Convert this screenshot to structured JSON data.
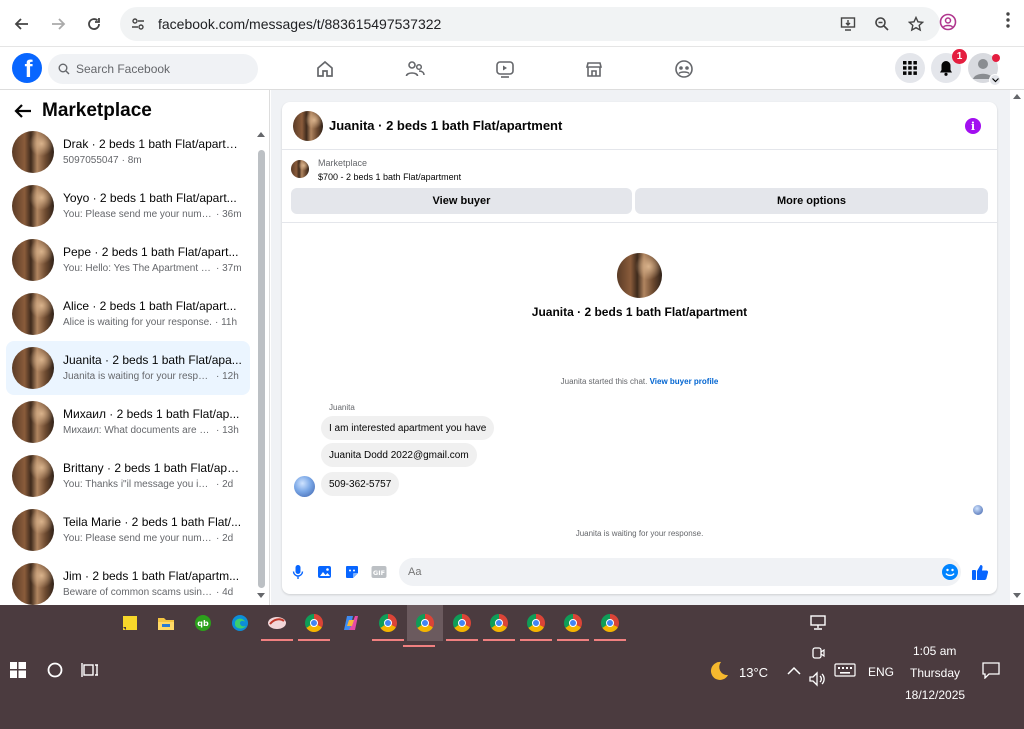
{
  "browser": {
    "url": "facebook.com/messages/t/883615497537322"
  },
  "fb_header": {
    "search_placeholder": "Search Facebook",
    "notification_count": "1"
  },
  "sidebar": {
    "title": "Marketplace",
    "conversations": [
      {
        "name": "Drak · 2 beds 1 bath Flat/apartment",
        "snippet": "5097055047",
        "time": "· 8m",
        "active": false
      },
      {
        "name": "Yoyo · 2 beds 1 bath Flat/apart...",
        "snippet": "You: Please send me your numb...",
        "time": "· 36m",
        "active": false
      },
      {
        "name": "Pepe · 2 beds 1 bath Flat/apart...",
        "snippet": "You: Hello: Yes The Apartment Is ...",
        "time": "· 37m",
        "active": false
      },
      {
        "name": "Alice · 2 beds 1 bath Flat/apart...",
        "snippet": "Alice is waiting for your response.",
        "time": "· 11h",
        "active": false
      },
      {
        "name": "Juanita · 2 beds 1 bath Flat/apa...",
        "snippet": "Juanita is waiting for your respon...",
        "time": "· 12h",
        "active": true
      },
      {
        "name": "Михаил · 2 beds 1 bath Flat/ap...",
        "snippet": "Михаил: What documents are ne...",
        "time": "· 13h",
        "active": false
      },
      {
        "name": "Brittany · 2 beds 1 bath Flat/apa...",
        "snippet": "You: Thanks i\"il message you in a ...",
        "time": "· 2d",
        "active": false
      },
      {
        "name": "Teila Marie · 2 beds 1 bath Flat/...",
        "snippet": "You: Please send me your number ...",
        "time": "· 2d",
        "active": false
      },
      {
        "name": "Jim · 2 beds 1 bath Flat/apartm...",
        "snippet": "Beware of common scams using p...",
        "time": "· 4d",
        "active": false
      }
    ]
  },
  "chat": {
    "title": "Juanita · 2 beds 1 bath Flat/apartment",
    "listing_label": "Marketplace",
    "listing_price": "$700 - 2 beds 1 bath Flat/apartment",
    "view_buyer": "View buyer",
    "more_options": "More options",
    "profile_name": "Juanita · 2 beds 1 bath Flat/apartment",
    "started_text": "Juanita started this chat.",
    "view_profile": "View buyer profile",
    "sender": "Juanita",
    "messages": [
      "I am interested apartment you have",
      "Juanita Dodd 2022@gmail.com",
      "509-362-5757"
    ],
    "waiting": "Juanita is waiting for your response.",
    "composer_placeholder": "Aa"
  },
  "taskbar": {
    "weather": "13°C",
    "language": "ENG",
    "time": "1:05 am",
    "day": "Thursday",
    "date": "18/12/2025"
  },
  "colors": {
    "fb_blue": "#0866ff",
    "active_row": "#ebf5ff",
    "taskbar": "#4b3b3f"
  }
}
